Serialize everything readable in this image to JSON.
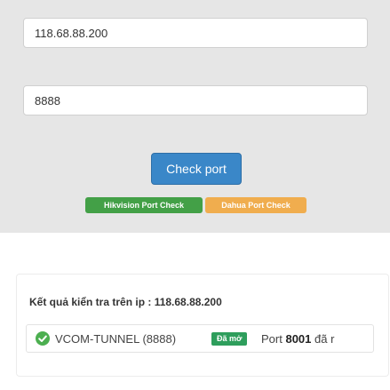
{
  "form": {
    "ip_value": "118.68.88.200",
    "port_value": "8888",
    "check_button": "Check port",
    "hikvision_button": "Hikvision Port Check",
    "dahua_button": "Dahua Port Check"
  },
  "result": {
    "title": "Kết quả kiển tra trên ip : 118.68.88.200",
    "rows": [
      {
        "icon": "check-circle-icon",
        "service": "VCOM-TUNNEL (8888)",
        "status": "Đã mở",
        "port_prefix": "Port ",
        "port_number": "8001",
        "port_suffix": " đã r"
      }
    ]
  },
  "colors": {
    "panel_bg": "#e6e6e6",
    "primary": "#3a87c8",
    "success": "#43a047",
    "warning": "#f0ad4e",
    "badge_green": "#2e9e5c",
    "ok_icon": "#4caf50"
  }
}
